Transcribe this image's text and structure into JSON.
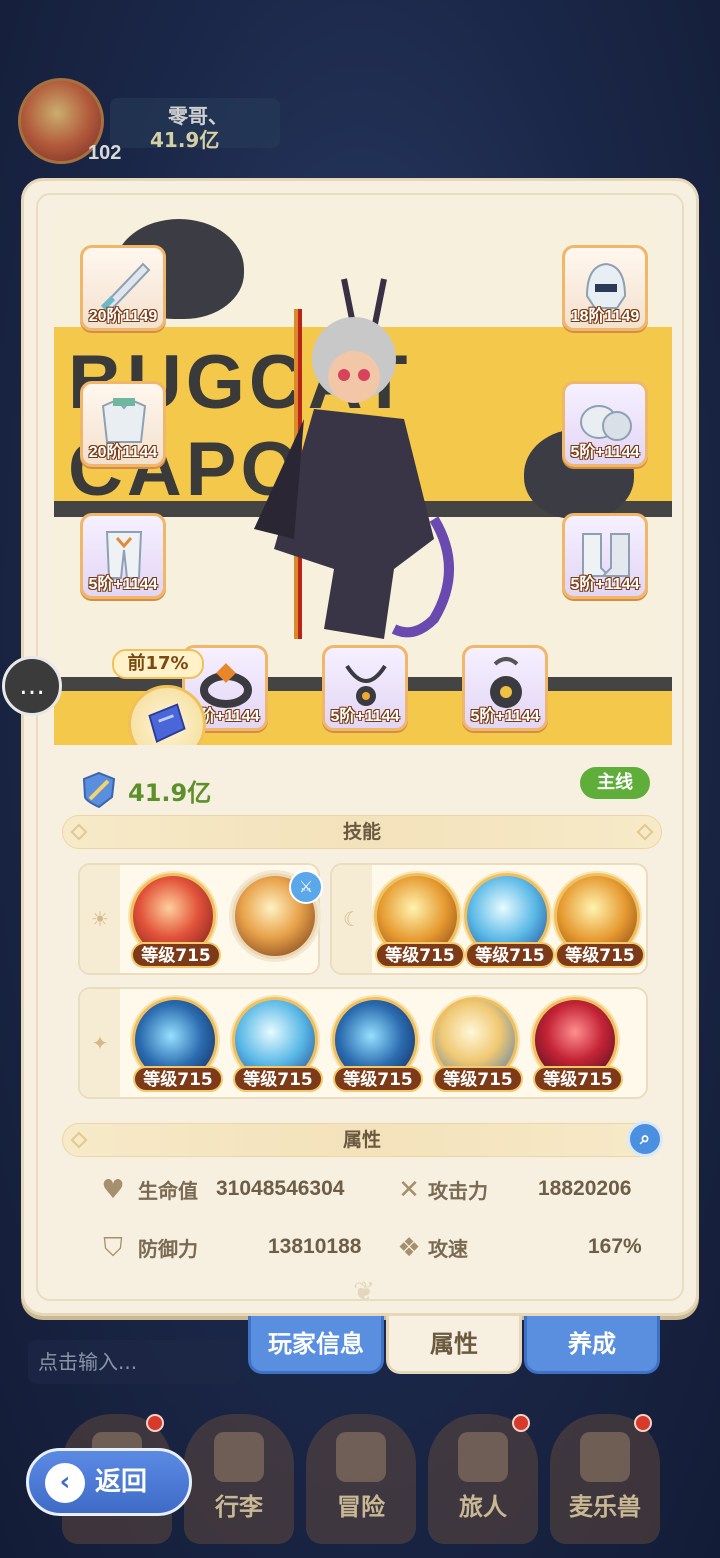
{
  "top": {
    "player_name": "零哥、",
    "power": "41.9亿",
    "level": "102"
  },
  "showcase": {
    "banner": "BUGCAT CAPOO",
    "equipment": [
      {
        "tag": "20阶1149"
      },
      {
        "tag": "18阶1149"
      },
      {
        "tag": "20阶1144"
      },
      {
        "tag": "5阶+1144"
      },
      {
        "tag": "5阶+1144"
      },
      {
        "tag": "5阶+1144"
      },
      {
        "tag": "5阶+1144"
      },
      {
        "tag": "5阶+1144"
      },
      {
        "tag": "5阶+1144"
      }
    ],
    "rank_bubble": "前17%"
  },
  "power_row": {
    "power": "41.9亿",
    "mainline": "主线"
  },
  "skills": {
    "title": "技能",
    "level_label": "等级715"
  },
  "attributes": {
    "title": "属性",
    "hp_label": "生命值",
    "hp_value": "31048546304",
    "atk_label": "攻击力",
    "atk_value": "18820206",
    "def_label": "防御力",
    "def_value": "13810188",
    "spd_label": "攻速",
    "spd_value": "167%"
  },
  "tabs": {
    "player_info": "玩家信息",
    "attributes": "属性",
    "cultivate": "养成"
  },
  "chat": {
    "placeholder": "点击输入..."
  },
  "nav": {
    "luggage": "行李",
    "adventure": "冒险",
    "traveler": "旅人",
    "pet": "麦乐兽",
    "back": "返回"
  },
  "colors": {
    "panel_bg": "#f7f0e1",
    "accent_blue": "#5a8fe0",
    "power_green": "#5d8f2a",
    "badge_green": "#5fae3a"
  }
}
